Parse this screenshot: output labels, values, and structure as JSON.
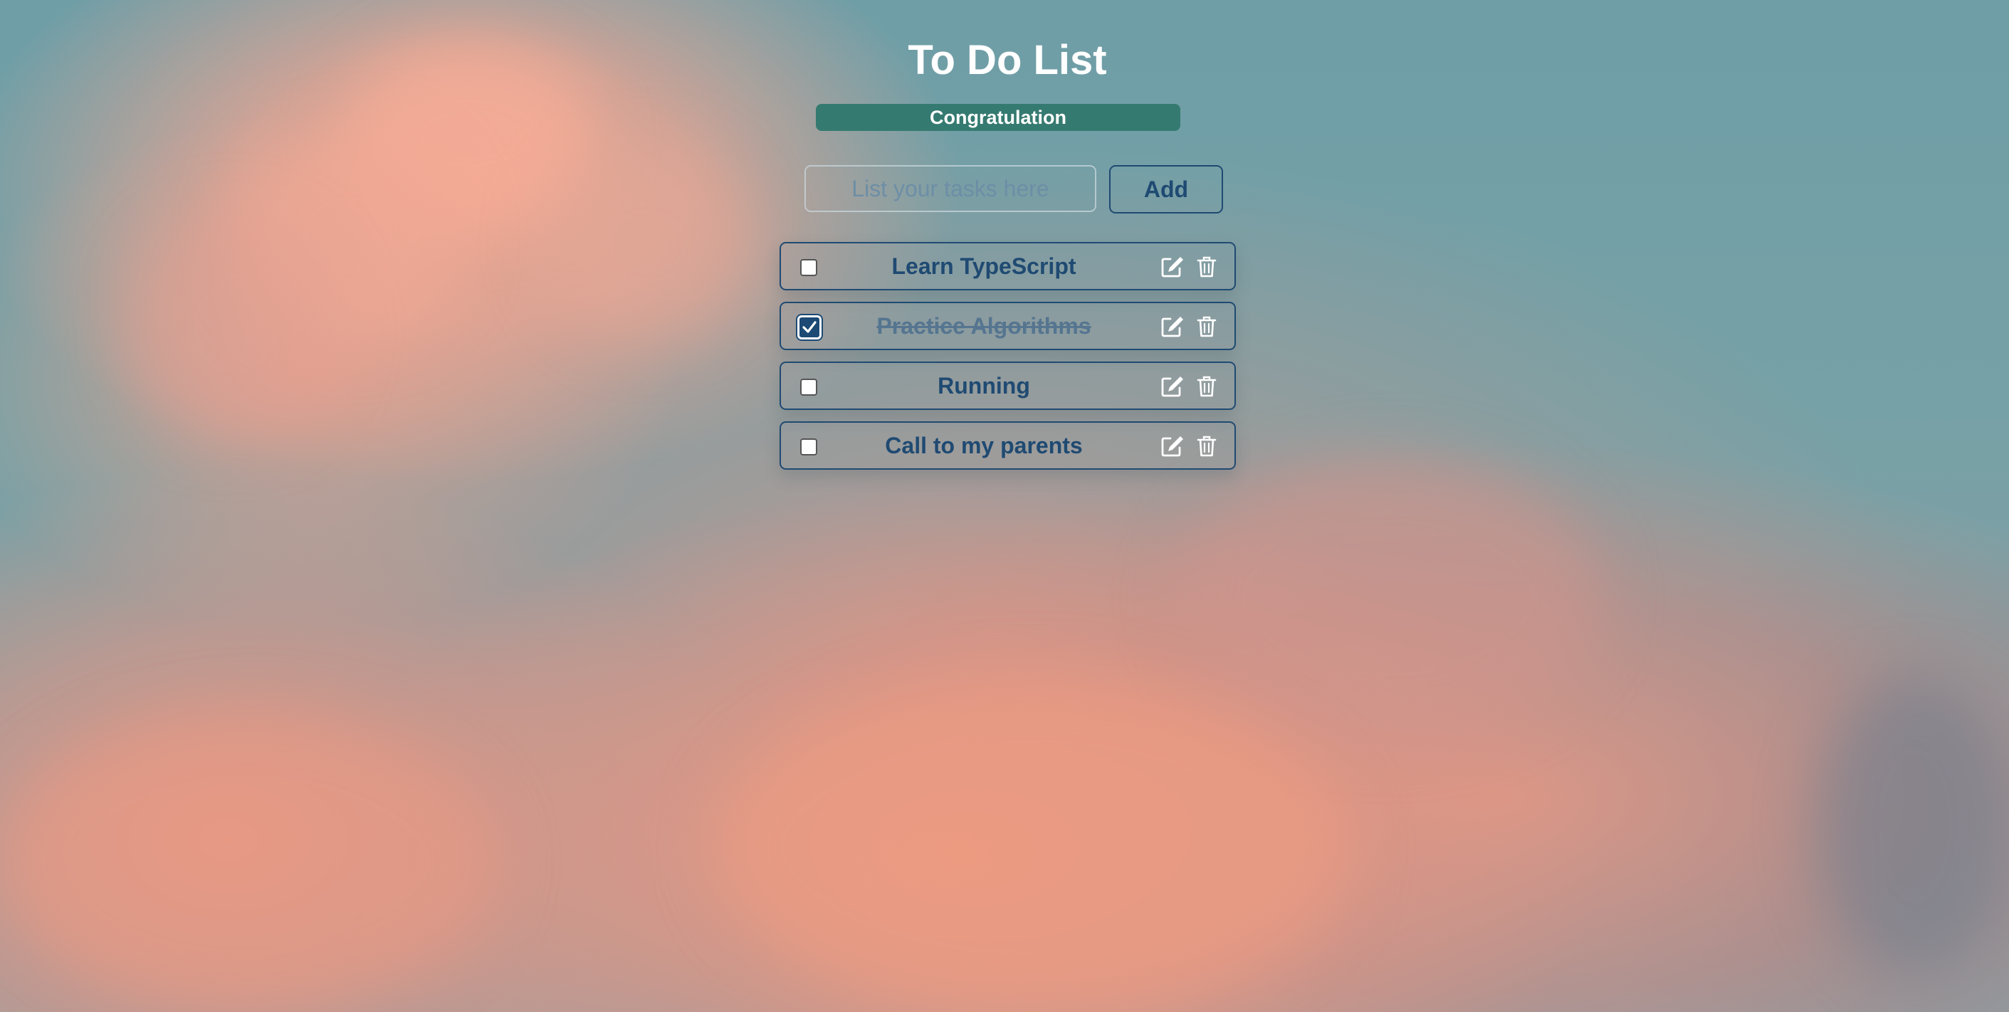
{
  "app": {
    "title": "To Do List",
    "banner": "Congratulation"
  },
  "form": {
    "placeholder": "List your tasks here",
    "value": "",
    "add_label": "Add"
  },
  "tasks": [
    {
      "label": "Learn TypeScript",
      "completed": false
    },
    {
      "label": "Practice Algorithms",
      "completed": true
    },
    {
      "label": "Running",
      "completed": false
    },
    {
      "label": "Call to my parents",
      "completed": false
    }
  ],
  "icons": {
    "edit": "pen-square-icon",
    "delete": "trash-icon",
    "check": "checkmark-icon"
  },
  "colors": {
    "accent": "#1f4a72",
    "banner_background": "#357a70",
    "title_text": "#ffffff",
    "sky": "#74a1a6",
    "cloud": "#f0a58e"
  }
}
